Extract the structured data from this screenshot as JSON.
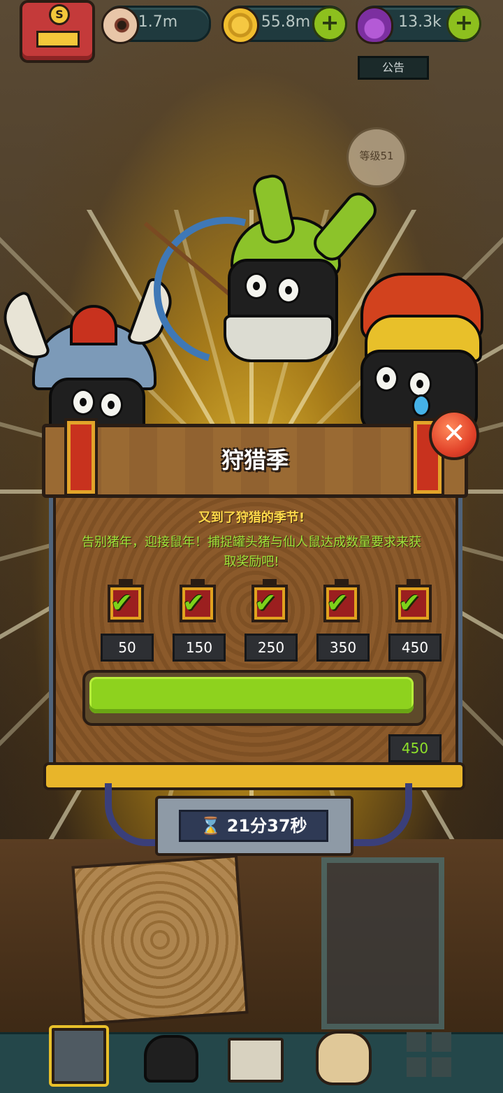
{
  "resources": {
    "eyes": "1.7m",
    "coins": "55.8m",
    "potion": "13.3k"
  },
  "background": {
    "sign": "公告",
    "level": "等级51"
  },
  "dialog": {
    "title": "狩猎季",
    "subtitle": "又到了狩猎的季节!",
    "description": "告别猪年，迎接鼠年！捕捉罐头猪与仙人鼠达成数量要求来获取奖励吧!",
    "milestones": [
      "50",
      "150",
      "250",
      "350",
      "450"
    ],
    "progress_fraction": 1.0,
    "current_count": "450",
    "timer": "21分37秒",
    "close_symbol": "✕"
  },
  "colors": {
    "progress": "#8ed21e",
    "title_text": "#ffffff",
    "subtitle_text": "#ffd84a",
    "desc_text": "#9fe23a"
  },
  "nav_icons": [
    "building-icon",
    "monsters-icon",
    "book-icon",
    "money-bag-icon",
    "grid-menu-icon"
  ]
}
